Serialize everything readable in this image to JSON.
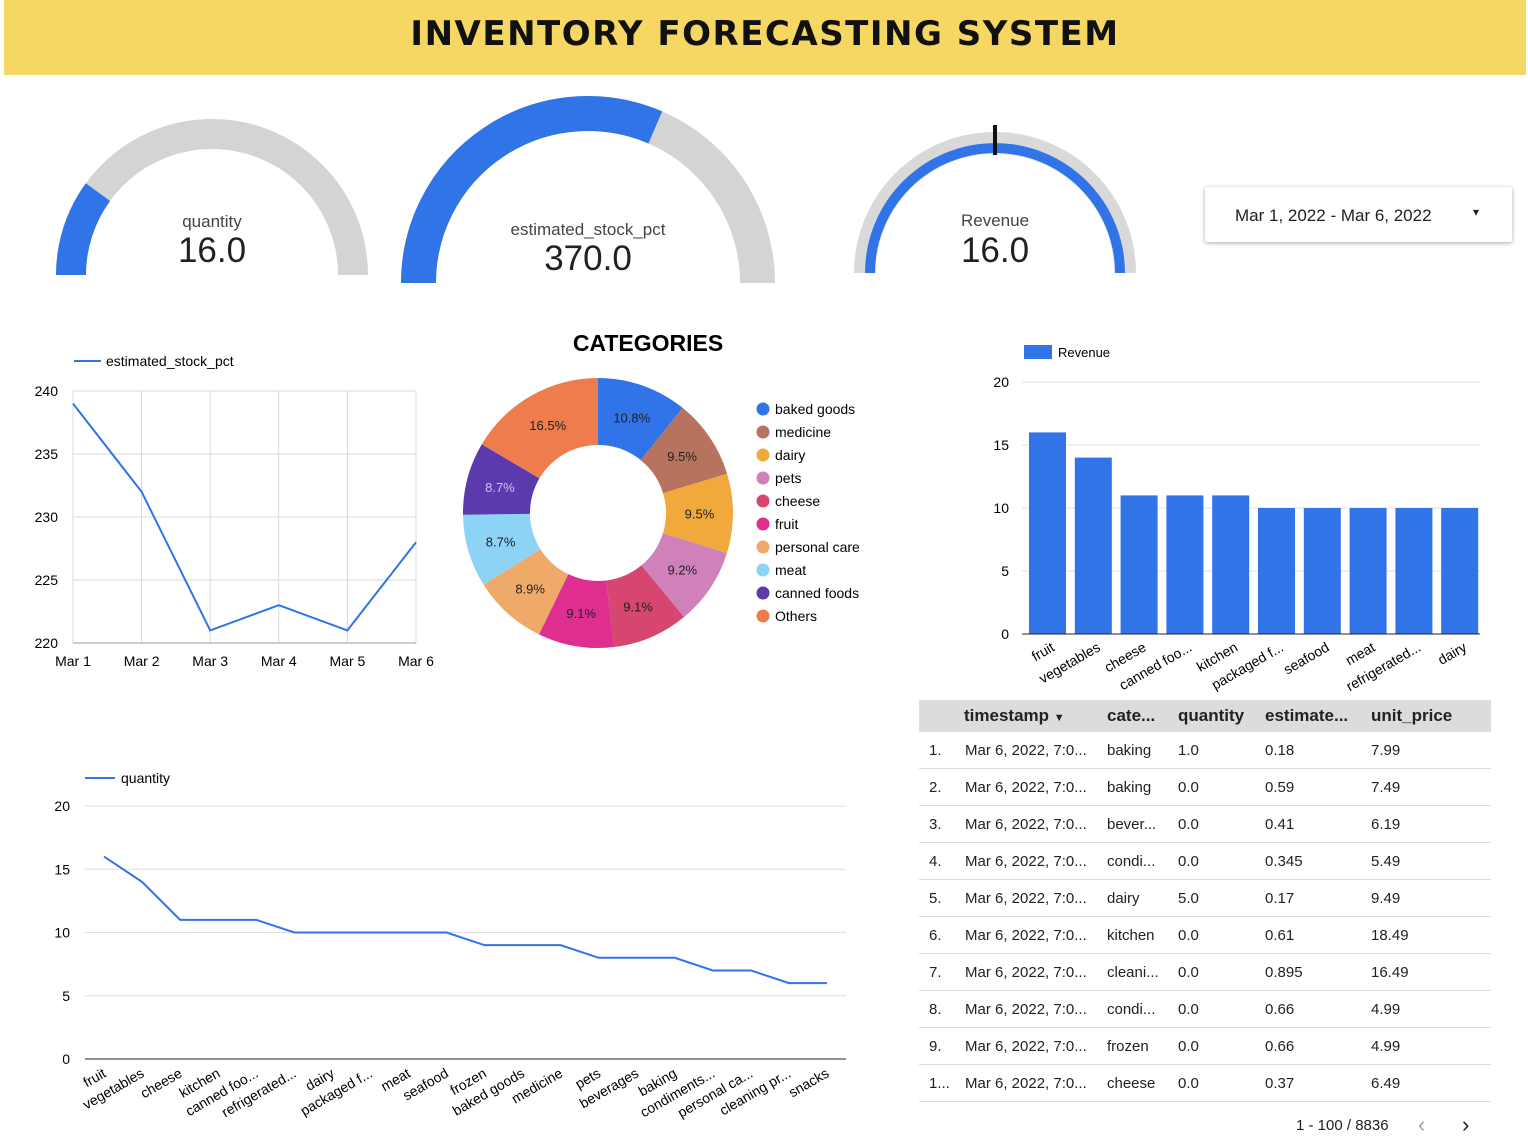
{
  "header": {
    "title": "INVENTORY FORECASTING SYSTEM",
    "bg_color": "#f7d764"
  },
  "colors": {
    "primary": "#3174e8",
    "track": "#d4d4d4"
  },
  "gauges": [
    {
      "label": "quantity",
      "value_text": "16.0",
      "fraction": 0.2
    },
    {
      "label": "estimated_stock_pct",
      "value_text": "370.0",
      "fraction": 0.63
    },
    {
      "label": "Revenue",
      "value_text": "16.0",
      "fraction": 1.0,
      "target_fraction": 0.5
    }
  ],
  "date_range": {
    "label": "Mar 1, 2022 - Mar 6, 2022",
    "caret": "▾"
  },
  "chart_data": [
    {
      "type": "line",
      "legend": [
        "estimated_stock_pct"
      ],
      "legend_position": "top-left",
      "x": [
        "Mar 1",
        "Mar 2",
        "Mar 3",
        "Mar 4",
        "Mar 5",
        "Mar 6"
      ],
      "series": [
        {
          "name": "estimated_stock_pct",
          "values": [
            239,
            232,
            221,
            223,
            221,
            228
          ]
        }
      ],
      "ylim": [
        220,
        240
      ],
      "yticks": [
        220,
        225,
        230,
        235,
        240
      ],
      "grid": true
    },
    {
      "type": "pie",
      "title": "CATEGORIES",
      "donut": true,
      "legend_position": "right",
      "slices": [
        {
          "label": "baked goods",
          "value": 10.8,
          "text": "10.8%",
          "color": "#3174e8"
        },
        {
          "label": "medicine",
          "value": 9.5,
          "text": "9.5%",
          "color": "#b8735f"
        },
        {
          "label": "dairy",
          "value": 9.5,
          "text": "9.5%",
          "color": "#f2a93b"
        },
        {
          "label": "pets",
          "value": 9.2,
          "text": "9.2%",
          "color": "#d081b9"
        },
        {
          "label": "cheese",
          "value": 9.1,
          "text": "9.1%",
          "color": "#d6466f"
        },
        {
          "label": "fruit",
          "value": 9.1,
          "text": "9.1%",
          "color": "#de2e8f"
        },
        {
          "label": "personal care",
          "value": 8.9,
          "text": "8.9%",
          "color": "#efaa6a"
        },
        {
          "label": "meat",
          "value": 8.7,
          "text": "8.7%",
          "color": "#8dd3f5"
        },
        {
          "label": "canned foods",
          "value": 8.7,
          "text": "8.7%",
          "color": "#5b3aad"
        },
        {
          "label": "Others",
          "value": 16.5,
          "text": "16.5%",
          "color": "#ef7c4d"
        }
      ]
    },
    {
      "type": "bar",
      "legend": [
        "Revenue"
      ],
      "legend_position": "top-left",
      "categories": [
        "fruit",
        "vegetables",
        "cheese",
        "canned foo...",
        "kitchen",
        "packaged f...",
        "seafood",
        "meat",
        "refrigerated...",
        "dairy"
      ],
      "series": [
        {
          "name": "Revenue",
          "values": [
            16,
            14,
            11,
            11,
            11,
            10,
            10,
            10,
            10,
            10
          ]
        }
      ],
      "ylim": [
        0,
        20
      ],
      "yticks": [
        0,
        5,
        10,
        15,
        20
      ],
      "grid": true
    },
    {
      "type": "line",
      "legend": [
        "quantity"
      ],
      "legend_position": "top-left",
      "categories": [
        "fruit",
        "vegetables",
        "cheese",
        "kitchen",
        "canned foo...",
        "refrigerated...",
        "dairy",
        "packaged f...",
        "meat",
        "seafood",
        "frozen",
        "baked goods",
        "medicine",
        "pets",
        "beverages",
        "baking",
        "condiments...",
        "personal ca...",
        "cleaning pr...",
        "snacks"
      ],
      "series": [
        {
          "name": "quantity",
          "values": [
            16,
            14,
            11,
            11,
            11,
            10,
            10,
            10,
            10,
            10,
            9,
            9,
            9,
            8,
            8,
            8,
            7,
            7,
            6,
            6
          ]
        }
      ],
      "ylim": [
        0,
        20
      ],
      "yticks": [
        0,
        5,
        10,
        15,
        20
      ],
      "grid": true
    }
  ],
  "table": {
    "columns": [
      "timestamp",
      "cate...",
      "quantity",
      "estimate...",
      "unit_price"
    ],
    "sort_indicator": "▼",
    "rows": [
      {
        "idx": "1.",
        "timestamp": "Mar 6, 2022, 7:0...",
        "category": "baking",
        "quantity": "1.0",
        "estimated": "0.18",
        "unit_price": "7.99"
      },
      {
        "idx": "2.",
        "timestamp": "Mar 6, 2022, 7:0...",
        "category": "baking",
        "quantity": "0.0",
        "estimated": "0.59",
        "unit_price": "7.49"
      },
      {
        "idx": "3.",
        "timestamp": "Mar 6, 2022, 7:0...",
        "category": "bever...",
        "quantity": "0.0",
        "estimated": "0.41",
        "unit_price": "6.19"
      },
      {
        "idx": "4.",
        "timestamp": "Mar 6, 2022, 7:0...",
        "category": "condi...",
        "quantity": "0.0",
        "estimated": "0.345",
        "unit_price": "5.49"
      },
      {
        "idx": "5.",
        "timestamp": "Mar 6, 2022, 7:0...",
        "category": "dairy",
        "quantity": "5.0",
        "estimated": "0.17",
        "unit_price": "9.49"
      },
      {
        "idx": "6.",
        "timestamp": "Mar 6, 2022, 7:0...",
        "category": "kitchen",
        "quantity": "0.0",
        "estimated": "0.61",
        "unit_price": "18.49"
      },
      {
        "idx": "7.",
        "timestamp": "Mar 6, 2022, 7:0...",
        "category": "cleani...",
        "quantity": "0.0",
        "estimated": "0.895",
        "unit_price": "16.49"
      },
      {
        "idx": "8.",
        "timestamp": "Mar 6, 2022, 7:0...",
        "category": "condi...",
        "quantity": "0.0",
        "estimated": "0.66",
        "unit_price": "4.99"
      },
      {
        "idx": "9.",
        "timestamp": "Mar 6, 2022, 7:0...",
        "category": "frozen",
        "quantity": "0.0",
        "estimated": "0.66",
        "unit_price": "4.99"
      },
      {
        "idx": "1...",
        "timestamp": "Mar 6, 2022, 7:0...",
        "category": "cheese",
        "quantity": "0.0",
        "estimated": "0.37",
        "unit_price": "6.49"
      }
    ],
    "pagination": {
      "text": "1 - 100 / 8836",
      "prev": "‹",
      "next": "›"
    }
  }
}
